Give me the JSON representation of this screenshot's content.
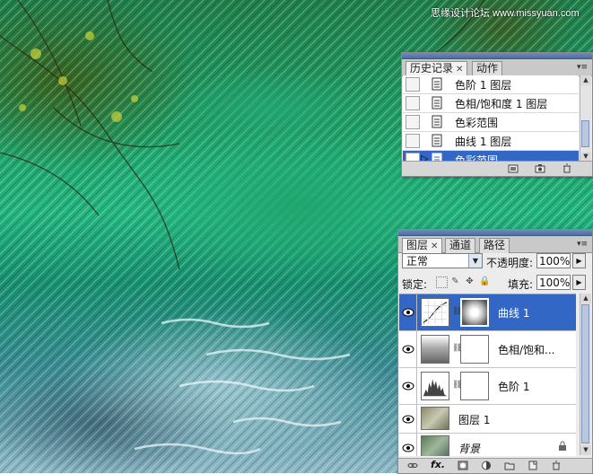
{
  "watermark": "思缘设计论坛 www.missyuan.com",
  "history_panel": {
    "tabs": [
      {
        "label": "历史记录",
        "active": true,
        "closable": true
      },
      {
        "label": "动作",
        "active": false,
        "closable": false
      }
    ],
    "items": [
      {
        "label": "色阶 1 图层",
        "selected": false
      },
      {
        "label": "色相/饱和度 1 图层",
        "selected": false
      },
      {
        "label": "色彩范围",
        "selected": false
      },
      {
        "label": "曲线 1 图层",
        "selected": false
      },
      {
        "label": "色彩范围",
        "selected": true
      }
    ],
    "footer_icons": [
      "new-document-from-state-icon",
      "new-snapshot-icon",
      "trash-icon"
    ]
  },
  "layers_panel": {
    "tabs": [
      {
        "label": "图层",
        "active": true,
        "closable": true
      },
      {
        "label": "通道",
        "active": false,
        "closable": false
      },
      {
        "label": "路径",
        "active": false,
        "closable": false
      }
    ],
    "blend_mode": "正常",
    "opacity_label": "不透明度:",
    "opacity_value": "100%",
    "lock_label": "锁定:",
    "fill_label": "填充:",
    "fill_value": "100%",
    "layers": [
      {
        "name": "曲线 1",
        "kind": "adjustment-curves",
        "selected": true,
        "visible": true
      },
      {
        "name": "色相/饱和...",
        "kind": "adjustment-hue-saturation",
        "selected": false,
        "visible": true
      },
      {
        "name": "色阶 1",
        "kind": "adjustment-levels",
        "selected": false,
        "visible": true
      },
      {
        "name": "图层 1",
        "kind": "pixel",
        "selected": false,
        "visible": true
      },
      {
        "name": "背景",
        "kind": "background",
        "selected": false,
        "visible": true,
        "locked": true
      }
    ],
    "footer_icons": [
      "link-layers-icon",
      "fx-icon",
      "mask-icon",
      "adjustment-layer-icon",
      "group-folder-icon",
      "new-layer-icon",
      "trash-icon"
    ],
    "fx_text": "fx."
  },
  "colors": {
    "selection_blue": "#3367c6",
    "panel_gray": "#ececec",
    "water_green": "#1fa36b"
  }
}
